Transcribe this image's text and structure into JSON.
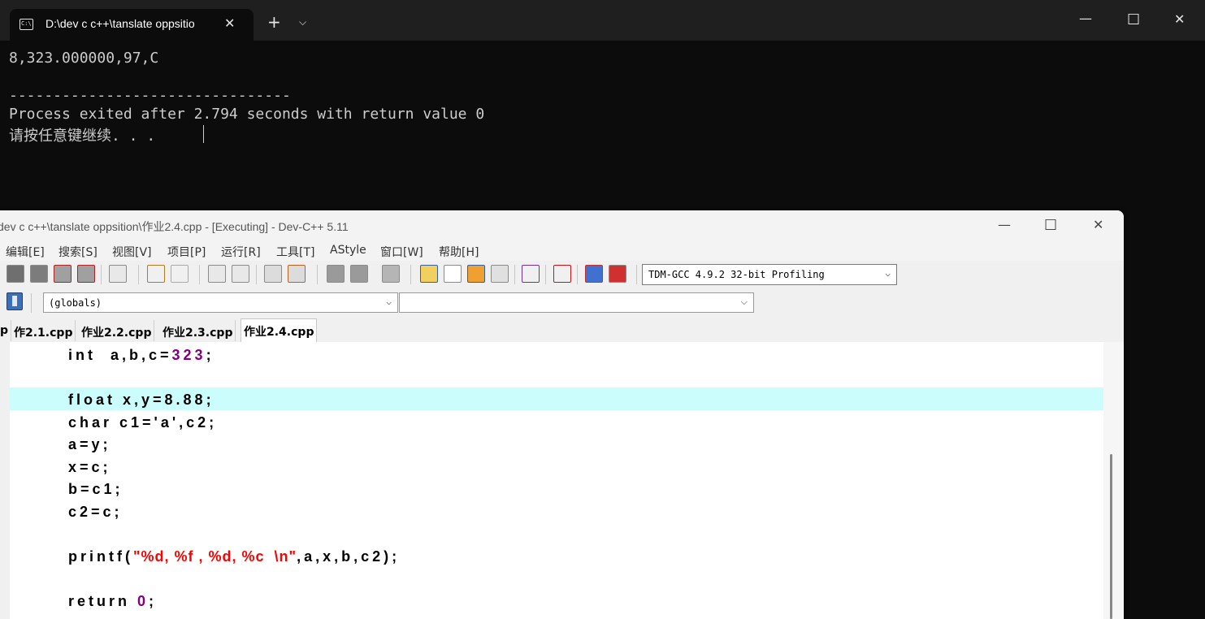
{
  "terminal": {
    "tab_title": "D:\\dev c c++\\tanslate oppsitio",
    "tab_icon": "terminal-icon",
    "icon_text": "C:\\",
    "close_glyph": "✕",
    "new_tab_glyph": "+",
    "dropdown_glyph": "⌵",
    "minimize_glyph": "—",
    "maximize_glyph": "☐",
    "window_close_glyph": "✕",
    "lines": [
      "8,323.000000,97,C",
      "",
      "--------------------------------",
      "Process exited after 2.794 seconds with return value 0",
      "请按任意键继续. . ."
    ]
  },
  "devcpp": {
    "title": "dev c c++\\tanslate oppsition\\作业2.4.cpp - [Executing] - Dev-C++ 5.11",
    "minimize_glyph": "—",
    "maximize_glyph": "☐",
    "close_glyph": "✕",
    "menu": [
      "编辑[E]",
      "搜索[S]",
      "视图[V]",
      "项目[P]",
      "运行[R]",
      "工具[T]",
      "AStyle",
      "窗口[W]",
      "帮助[H]"
    ],
    "compiler": "TDM-GCC 4.9.2 32-bit Profiling",
    "chevron_glyph": "⌵",
    "scope_select": "(globals)",
    "member_select": "",
    "file_tabs": [
      "p",
      "作2.1.cpp",
      "作业2.2.cpp",
      "作业2.3.cpp",
      "作业2.4.cpp"
    ],
    "active_tab": "作业2.4.cpp",
    "code": {
      "l1_a": "int  a,b,c=",
      "l1_num": "323",
      "l1_b": ";",
      "l3": "float x,y=8.88;",
      "l4": "char c1='a',c2;",
      "l5": "a=y;",
      "l6": "x=c;",
      "l7": "b=c1;",
      "l8": "c2=c;",
      "l10_a": "printf(",
      "l10_str": "\"%d, %f , %d, %c  \\n\"",
      "l10_b": ",a,x,b,c2);",
      "l12_a": "return ",
      "l12_num": "0",
      "l12_b": ";"
    },
    "colors": {
      "highlight_row": "#ccfdfd",
      "number": "#800080",
      "string": "#ff0000"
    }
  }
}
